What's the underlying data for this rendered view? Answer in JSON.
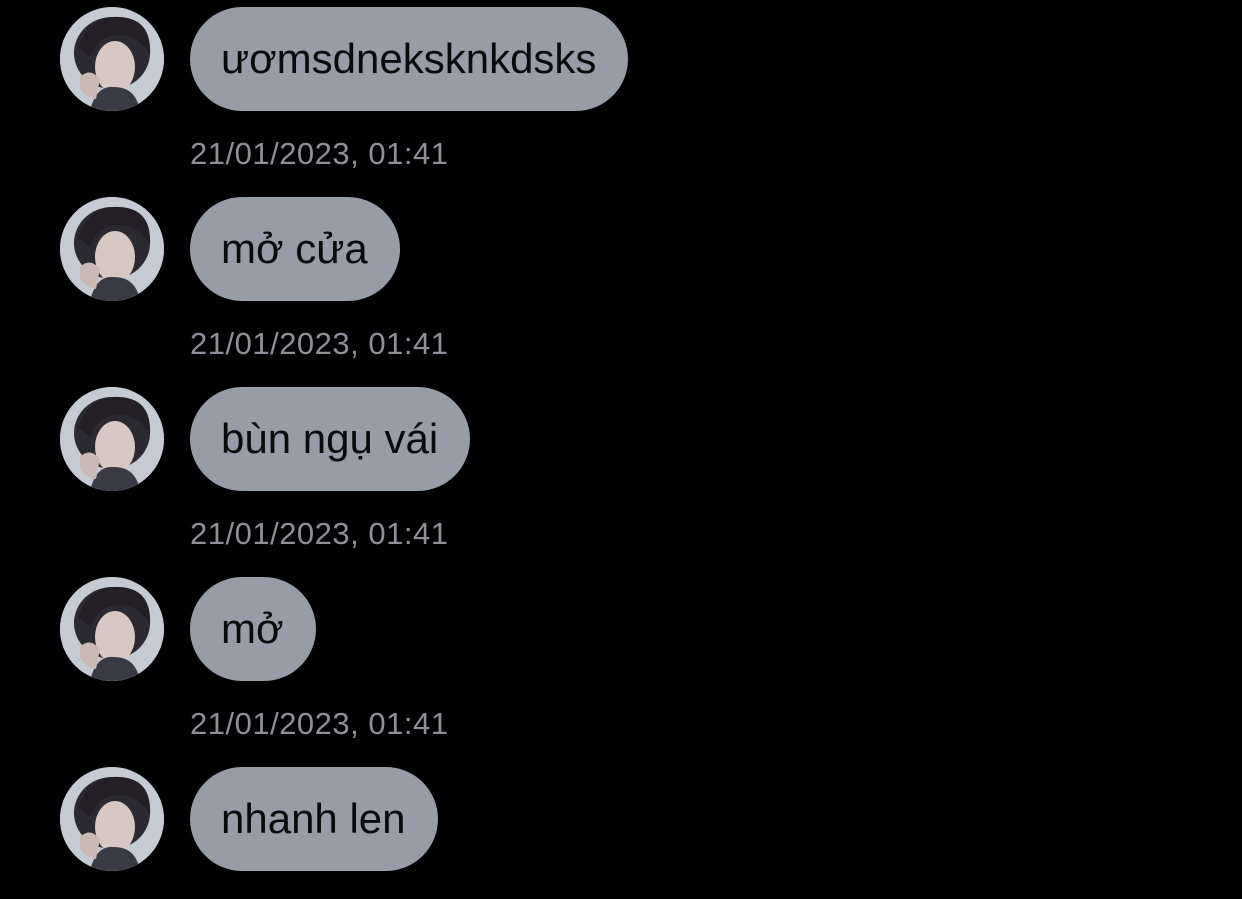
{
  "colors": {
    "background": "#000000",
    "bubble": "#979ca6",
    "bubble_text": "#0b0b0d",
    "timestamp_text": "#8d9099"
  },
  "messages": [
    {
      "text": "ươmsdneksknkdsks",
      "avatar_icon": "profile-photo-icon"
    },
    {
      "text": "mở cửa",
      "avatar_icon": "profile-photo-icon"
    },
    {
      "text": "bùn ngụ vái",
      "avatar_icon": "profile-photo-icon"
    },
    {
      "text": "mở",
      "avatar_icon": "profile-photo-icon"
    },
    {
      "text": "nhanh len",
      "avatar_icon": "profile-photo-icon"
    }
  ],
  "timestamps": [
    "21/01/2023, 01:41",
    "21/01/2023, 01:41",
    "21/01/2023, 01:41",
    "21/01/2023, 01:41"
  ]
}
